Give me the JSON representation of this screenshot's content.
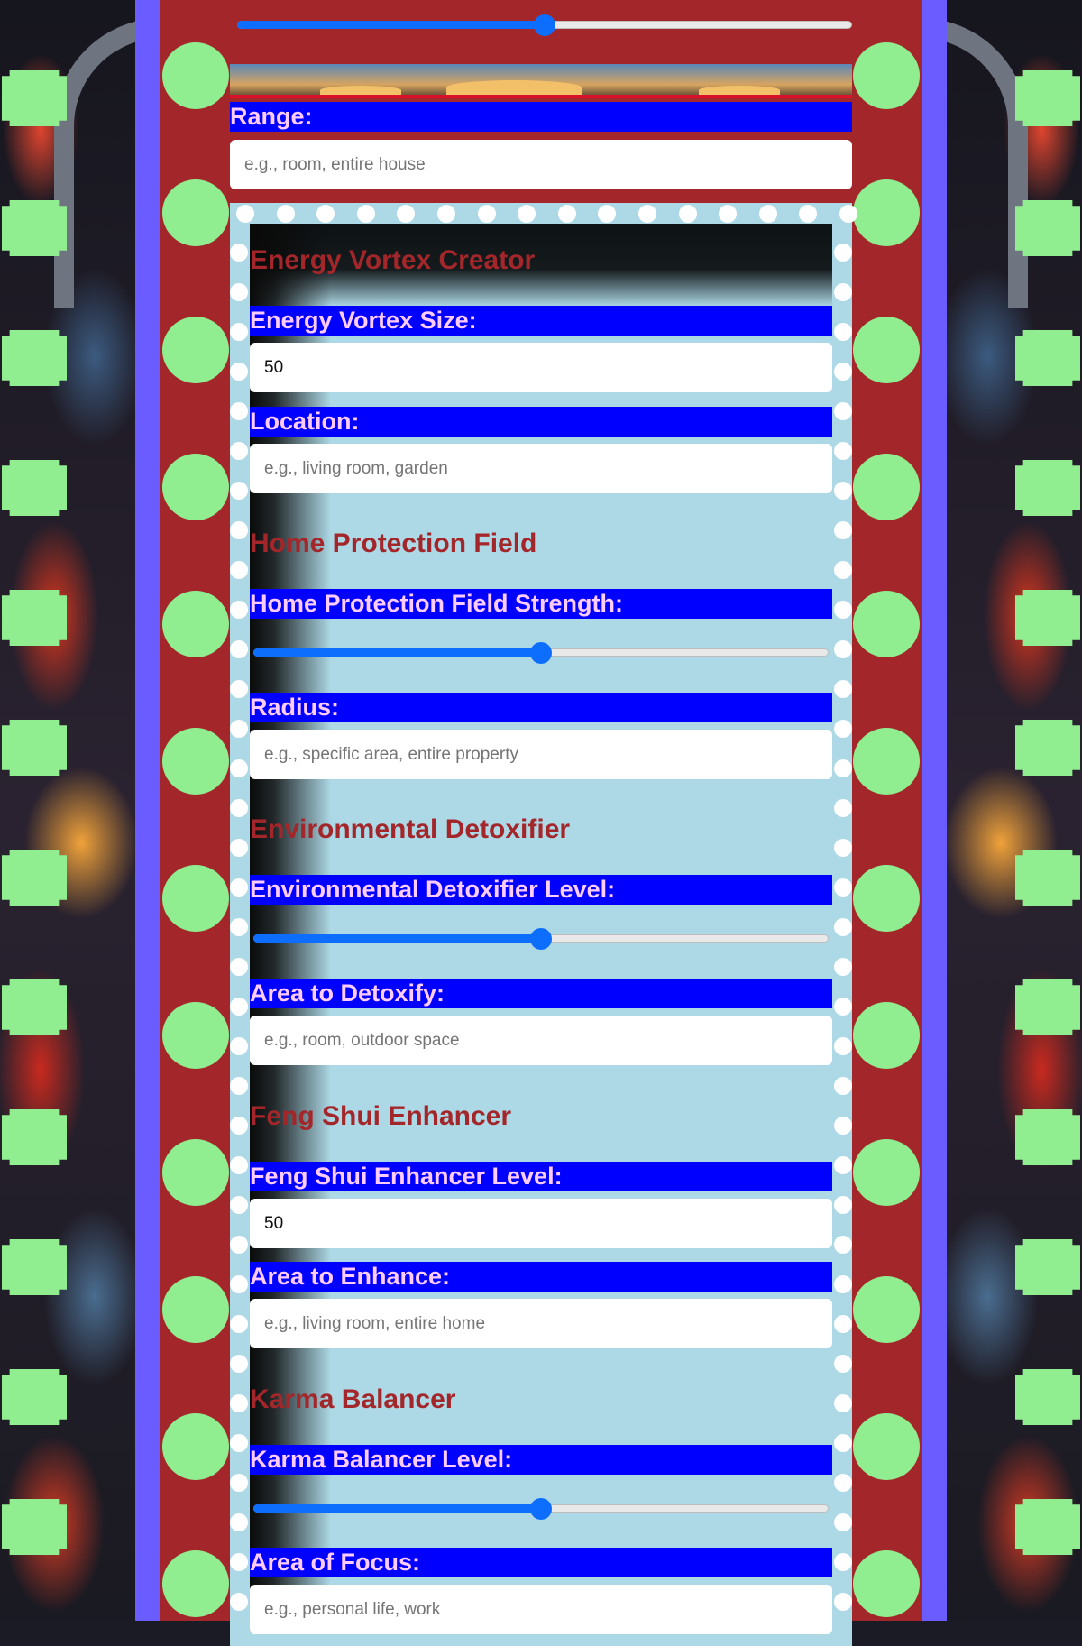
{
  "colors": {
    "frame_blue": "#6a5cff",
    "frame_red": "#a3272a",
    "panel": "#add8e6",
    "label_bar": "#0000ff",
    "label_text": "#ffccff",
    "section_title": "#a3272a",
    "dot": "#90ee90",
    "slider": "#0d6efd"
  },
  "top_slider": {
    "value": 50,
    "max": 100
  },
  "range": {
    "label": "Range:",
    "placeholder": "e.g., room, entire house"
  },
  "energy_vortex": {
    "title": "Energy Vortex Creator",
    "size_label": "Energy Vortex Size:",
    "size_value": "50",
    "location_label": "Location:",
    "location_placeholder": "e.g., living room, garden"
  },
  "home_protection": {
    "title": "Home Protection Field",
    "strength_label": "Home Protection Field Strength:",
    "strength_value": 50,
    "radius_label": "Radius:",
    "radius_placeholder": "e.g., specific area, entire property"
  },
  "detoxifier": {
    "title": "Environmental Detoxifier",
    "level_label": "Environmental Detoxifier Level:",
    "level_value": 50,
    "area_label": "Area to Detoxify:",
    "area_placeholder": "e.g., room, outdoor space"
  },
  "feng_shui": {
    "title": "Feng Shui Enhancer",
    "level_label": "Feng Shui Enhancer Level:",
    "level_value": "50",
    "area_label": "Area to Enhance:",
    "area_placeholder": "e.g., living room, entire home"
  },
  "karma": {
    "title": "Karma Balancer",
    "level_label": "Karma Balancer Level:",
    "level_value": 50,
    "focus_label": "Area of Focus:",
    "focus_placeholder": "e.g., personal life, work"
  }
}
